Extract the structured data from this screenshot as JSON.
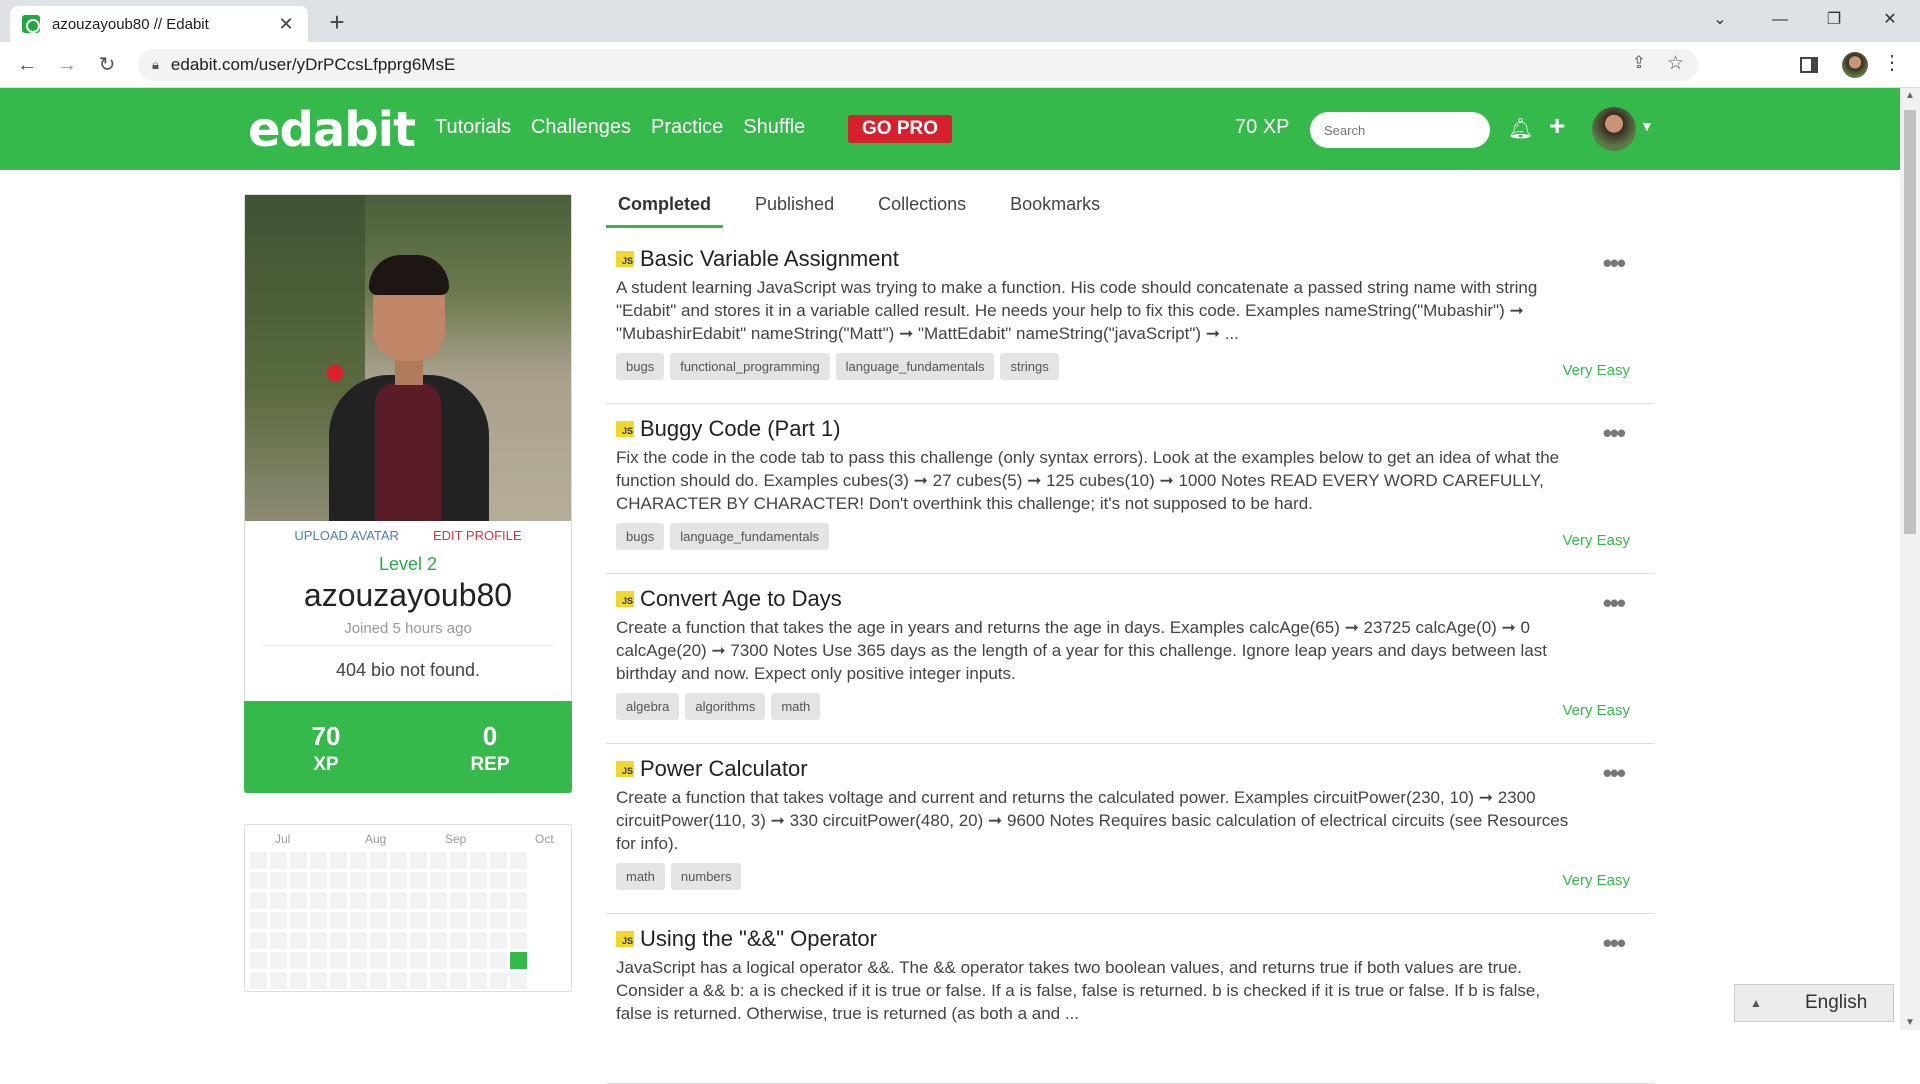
{
  "browser": {
    "tab_title": "azouzayoub80 // Edabit",
    "url": "edabit.com/user/yDrPCcsLfpprg6MsE"
  },
  "site": {
    "logo": "edabit",
    "nav": [
      "Tutorials",
      "Challenges",
      "Practice",
      "Shuffle"
    ],
    "gopro": "GO PRO",
    "xp": "70 XP",
    "search_placeholder": "Search"
  },
  "profile": {
    "upload_avatar": "UPLOAD AVATAR",
    "edit_profile": "EDIT PROFILE",
    "level": "Level 2",
    "username": "azouzayoub80",
    "joined": "Joined 5 hours ago",
    "bio": "404 bio not found.",
    "stats": [
      {
        "value": "70",
        "label": "XP"
      },
      {
        "value": "0",
        "label": "REP"
      }
    ]
  },
  "activity": {
    "months": [
      "Jul",
      "Aug",
      "Sep",
      "Oct"
    ],
    "active_color": "#34b94a"
  },
  "tabs": [
    "Completed",
    "Published",
    "Collections",
    "Bookmarks"
  ],
  "challenges": [
    {
      "lang": "JS",
      "title": "Basic Variable Assignment",
      "desc": "A student learning JavaScript was trying to make a function. His code should concatenate a passed string name with string \"Edabit\" and stores it in a variable called result. He needs your help to fix this code. Examples nameString(\"Mubashir\") ➞ \"MubashirEdabit\" nameString(\"Matt\") ➞ \"MattEdabit\" nameString(\"javaScript\") ➞ ...",
      "tags": [
        "bugs",
        "functional_programming",
        "language_fundamentals",
        "strings"
      ],
      "difficulty": "Very Easy"
    },
    {
      "lang": "JS",
      "title": "Buggy Code (Part 1)",
      "desc": "Fix the code in the code tab to pass this challenge (only syntax errors). Look at the examples below to get an idea of what the function should do. Examples cubes(3) ➞ 27 cubes(5) ➞ 125 cubes(10) ➞ 1000 Notes READ EVERY WORD CAREFULLY, CHARACTER BY CHARACTER! Don't overthink this challenge; it's not supposed to be hard.",
      "tags": [
        "bugs",
        "language_fundamentals"
      ],
      "difficulty": "Very Easy"
    },
    {
      "lang": "JS",
      "title": "Convert Age to Days",
      "desc": "Create a function that takes the age in years and returns the age in days. Examples calcAge(65) ➞ 23725 calcAge(0) ➞ 0 calcAge(20) ➞ 7300 Notes Use 365 days as the length of a year for this challenge. Ignore leap years and days between last birthday and now. Expect only positive integer inputs.",
      "tags": [
        "algebra",
        "algorithms",
        "math"
      ],
      "difficulty": "Very Easy"
    },
    {
      "lang": "JS",
      "title": "Power Calculator",
      "desc": "Create a function that takes voltage and current and returns the calculated power. Examples circuitPower(230, 10) ➞ 2300 circuitPower(110, 3) ➞ 330 circuitPower(480, 20) ➞ 9600 Notes Requires basic calculation of electrical circuits (see Resources for info).",
      "tags": [
        "math",
        "numbers"
      ],
      "difficulty": "Very Easy"
    },
    {
      "lang": "JS",
      "title": "Using the \"&&\" Operator",
      "desc": "JavaScript has a logical operator &&. The && operator takes two boolean values, and returns true if both values are true. Consider a && b: a is checked if it is true or false. If a is false, false is returned. b is checked if it is true or false. If b is false, false is returned. Otherwise, true is returned (as both a and ...",
      "tags": [],
      "difficulty": ""
    }
  ],
  "language": "English"
}
